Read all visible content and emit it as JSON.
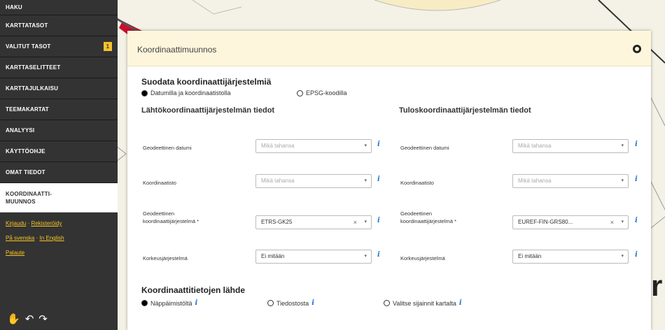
{
  "sidebar": {
    "items": [
      {
        "label": "HAKU"
      },
      {
        "label": "KARTTATASOT"
      },
      {
        "label": "VALITUT TASOT",
        "badge": "1"
      },
      {
        "label": "KARTTASELITTEET"
      },
      {
        "label": "KARTTAJULKAISU"
      },
      {
        "label": "TEEMAKARTAT"
      },
      {
        "label": "ANALYYSI"
      },
      {
        "label": "KÄYTTÖOHJE"
      },
      {
        "label": "OMAT TIEDOT"
      },
      {
        "label": "KOORDINAATTI-\nMUUNNOS"
      }
    ],
    "links": {
      "line1_a": "Kirjaudu",
      "line1_sep": " · ",
      "line1_b": "Rekisteröidy",
      "line2_a": "På svenska",
      "line2_sep": " · ",
      "line2_b": "In English",
      "line3_a": "Palaute"
    },
    "tools": {
      "hand": "✋",
      "undo": "↶",
      "redo": "↷"
    }
  },
  "map": {
    "fragment_text": "r"
  },
  "dialog": {
    "title": "Koordinaattimuunnos",
    "filter": {
      "title": "Suodata koordinaattijärjestelmiä",
      "option1": "Datumilla ja koordinaatistolla",
      "option2": "EPSG-koodilla",
      "selected": "option1"
    },
    "source": {
      "title": "Lähtökoordinaattijärjestelmän tiedot",
      "datum_label": "Geodeettinen datumi",
      "datum_value": "Mikä tahansa",
      "coord_label": "Koordinaatisto",
      "coord_value": "Mikä tahansa",
      "crs_label": "Geodeettinen koordinaattijärjestelmä *",
      "crs_value": "ETRS-GK25",
      "height_label": "Korkeusjärjestelmä",
      "height_value": "Ei mitään"
    },
    "target": {
      "title": "Tuloskoordinaattijärjestelmän tiedot",
      "datum_label": "Geodeettinen datumi",
      "datum_value": "Mikä tahansa",
      "coord_label": "Koordinaatisto",
      "coord_value": "Mikä tahansa",
      "crs_label": "Geodeettinen koordinaattijärjestelmä *",
      "crs_value": "EUREF-FIN-GRS80...",
      "height_label": "Korkeusjärjestelmä",
      "height_value": "Ei mitään"
    },
    "source_data": {
      "title": "Koordinaattitietojen lähde",
      "option1": "Näppäimistöltä",
      "option2": "Tiedostosta",
      "option3": "Valitse sijainnit kartalta",
      "selected": "option1"
    },
    "info_glyph": "i",
    "clear_glyph": "×",
    "arrow_glyph": "▾"
  },
  "colors": {
    "sidebar_bg": "#333333",
    "accent_yellow": "#f4c22a",
    "dialog_header_bg": "#fdf6dc",
    "info_blue": "#1e74d6"
  }
}
